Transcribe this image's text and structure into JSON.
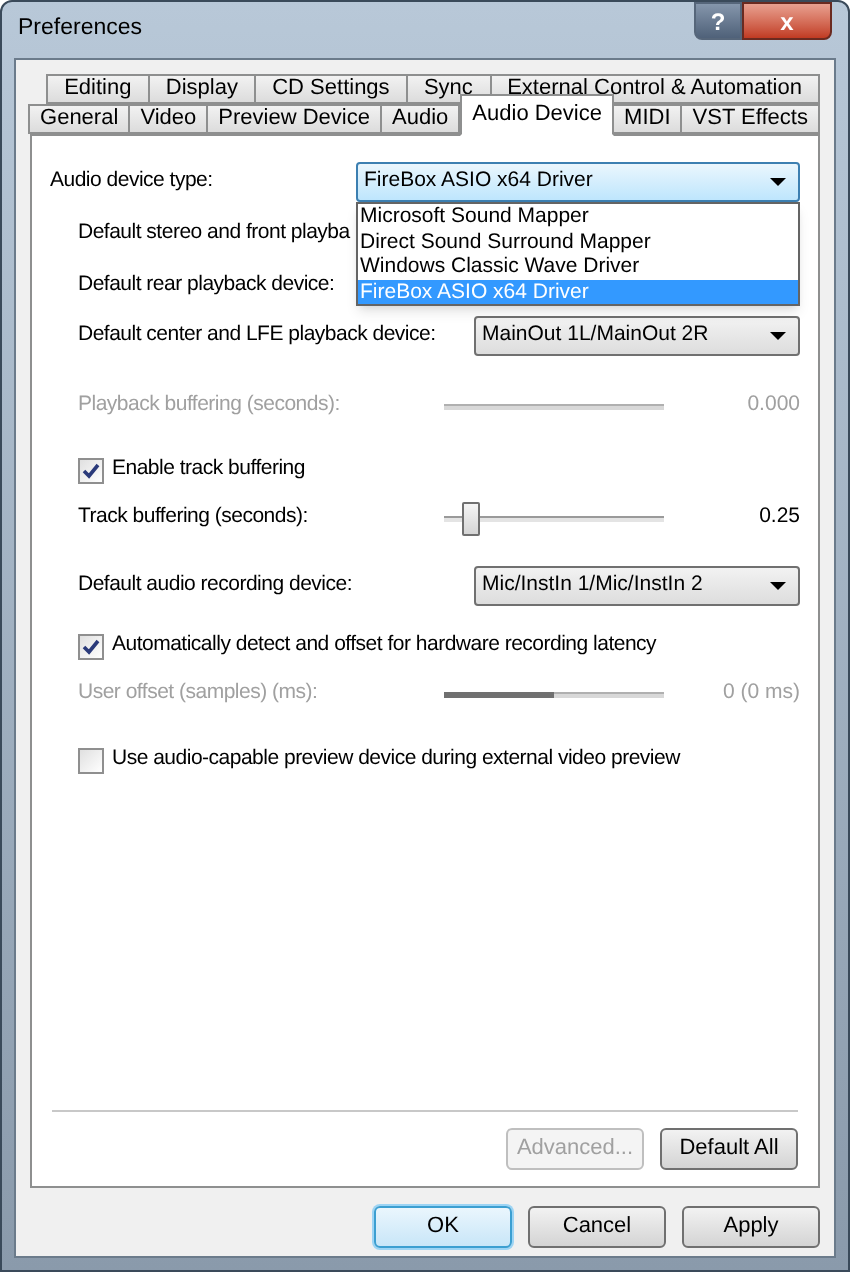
{
  "window": {
    "title": "Preferences",
    "help_button": "?",
    "close_button": "x"
  },
  "tab_rows": [
    [
      {
        "label": "Editing",
        "selected": false
      },
      {
        "label": "Display",
        "selected": false
      },
      {
        "label": "CD Settings",
        "selected": false
      },
      {
        "label": "Sync",
        "selected": false
      },
      {
        "label": "External Control & Automation",
        "selected": false
      }
    ],
    [
      {
        "label": "General",
        "selected": false
      },
      {
        "label": "Video",
        "selected": false
      },
      {
        "label": "Preview Device",
        "selected": false
      },
      {
        "label": "Audio",
        "selected": false
      },
      {
        "label": "Audio Device",
        "selected": true
      },
      {
        "label": "MIDI",
        "selected": false
      },
      {
        "label": "VST Effects",
        "selected": false
      }
    ]
  ],
  "settings": [
    {
      "kind": "combo",
      "label": "Audio device type:",
      "value": "FireBox ASIO x64 Driver",
      "focused": true,
      "open_list": [
        {
          "label": "Microsoft Sound Mapper",
          "selected": false
        },
        {
          "label": "Direct Sound Surround Mapper",
          "selected": false
        },
        {
          "label": "Windows Classic Wave Driver",
          "selected": false
        },
        {
          "label": "FireBox ASIO x64 Driver",
          "selected": true
        }
      ]
    },
    {
      "kind": "label",
      "label": "Default stereo and front playba"
    },
    {
      "kind": "label",
      "label": "Default rear playback device:"
    },
    {
      "kind": "combo",
      "label": "Default center and LFE playback device:",
      "value": "MainOut 1L/MainOut 2R",
      "focused": false
    },
    {
      "kind": "slider",
      "label": "Playback buffering (seconds):",
      "reading": "0.000",
      "disabled": true
    },
    {
      "kind": "checkbox",
      "label": "Enable track buffering",
      "checked": true
    },
    {
      "kind": "slider",
      "label": "Track buffering (seconds):",
      "reading": "0.25",
      "disabled": false,
      "level": 0.12
    },
    {
      "kind": "combo",
      "label": "Default audio recording device:",
      "value": "Mic/InstIn 1/Mic/InstIn 2",
      "focused": false
    },
    {
      "kind": "checkbox",
      "label": "Automatically detect and offset for hardware recording latency",
      "checked": true
    },
    {
      "kind": "slider",
      "label": "User offset (samples) (ms):",
      "reading": "0 (0 ms)",
      "disabled": true,
      "level": 0.5
    },
    {
      "kind": "checkbox",
      "label": "Use audio-capable preview device during external video preview",
      "checked": false
    }
  ],
  "panel_buttons": [
    {
      "label": "Advanced...",
      "disabled": true
    },
    {
      "label": "Default All",
      "disabled": false
    }
  ],
  "dialog_buttons": [
    {
      "label": "OK",
      "default": true
    },
    {
      "label": "Cancel",
      "default": false
    },
    {
      "label": "Apply",
      "default": false
    }
  ]
}
